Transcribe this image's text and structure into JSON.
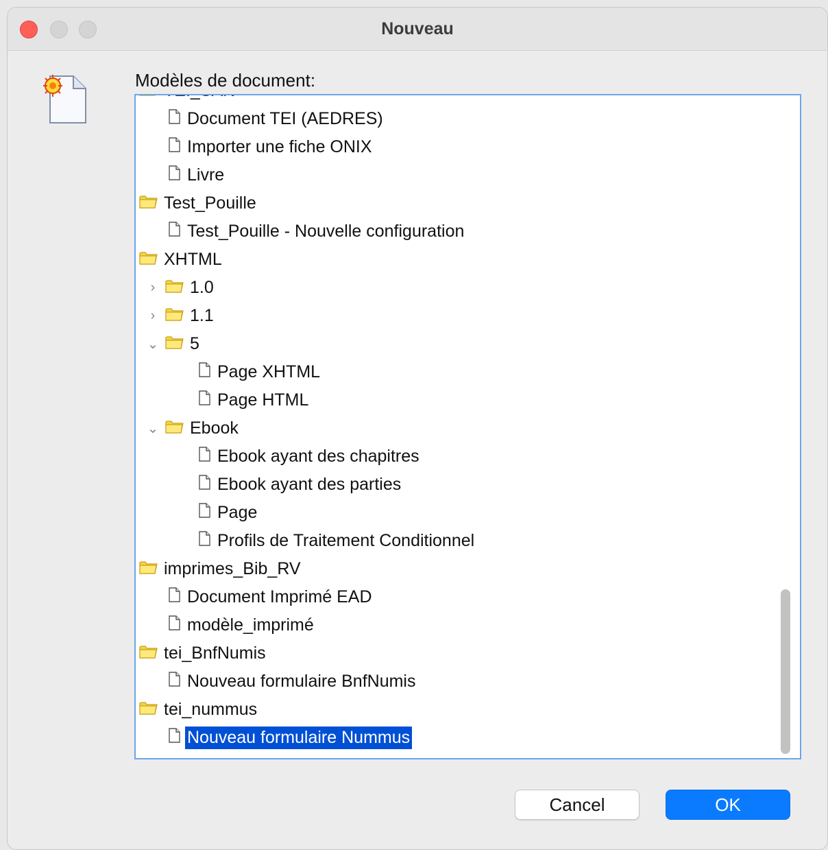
{
  "window": {
    "title": "Nouveau"
  },
  "list": {
    "label": "Modèles de document:"
  },
  "tree": [
    {
      "label": "TEI_SAN",
      "kind": "folder",
      "level": 0,
      "arrow": ""
    },
    {
      "label": "Document TEI (AEDRES)",
      "kind": "file",
      "level": 1,
      "arrow": ""
    },
    {
      "label": "Importer une fiche ONIX",
      "kind": "file",
      "level": 1,
      "arrow": ""
    },
    {
      "label": "Livre",
      "kind": "file",
      "level": 1,
      "arrow": ""
    },
    {
      "label": "Test_Pouille",
      "kind": "folder",
      "level": 0,
      "arrow": ""
    },
    {
      "label": "Test_Pouille - Nouvelle configuration",
      "kind": "file",
      "level": 1,
      "arrow": ""
    },
    {
      "label": "XHTML",
      "kind": "folder",
      "level": 0,
      "arrow": ""
    },
    {
      "label": "1.0",
      "kind": "folder",
      "level": 1,
      "arrow": "collapsed"
    },
    {
      "label": "1.1",
      "kind": "folder",
      "level": 1,
      "arrow": "collapsed"
    },
    {
      "label": "5",
      "kind": "folder",
      "level": 1,
      "arrow": "expanded"
    },
    {
      "label": "Page XHTML",
      "kind": "file",
      "level": 2,
      "arrow": ""
    },
    {
      "label": "Page HTML",
      "kind": "file",
      "level": 2,
      "arrow": ""
    },
    {
      "label": "Ebook",
      "kind": "folder",
      "level": 1,
      "arrow": "expanded"
    },
    {
      "label": "Ebook ayant des chapitres",
      "kind": "file",
      "level": 2,
      "arrow": ""
    },
    {
      "label": "Ebook ayant des parties",
      "kind": "file",
      "level": 2,
      "arrow": ""
    },
    {
      "label": "Page",
      "kind": "file",
      "level": 2,
      "arrow": ""
    },
    {
      "label": "Profils de Traitement Conditionnel",
      "kind": "file",
      "level": 2,
      "arrow": ""
    },
    {
      "label": "imprimes_Bib_RV",
      "kind": "folder",
      "level": 0,
      "arrow": ""
    },
    {
      "label": "Document Imprimé EAD",
      "kind": "file",
      "level": 1,
      "arrow": ""
    },
    {
      "label": "modèle_imprimé",
      "kind": "file",
      "level": 1,
      "arrow": ""
    },
    {
      "label": "tei_BnfNumis",
      "kind": "folder",
      "level": 0,
      "arrow": ""
    },
    {
      "label": "Nouveau formulaire BnfNumis",
      "kind": "file",
      "level": 1,
      "arrow": ""
    },
    {
      "label": "tei_nummus",
      "kind": "folder",
      "level": 0,
      "arrow": ""
    },
    {
      "label": "Nouveau formulaire Nummus",
      "kind": "file",
      "level": 1,
      "arrow": "",
      "selected": true
    }
  ],
  "buttons": {
    "cancel": "Cancel",
    "ok": "OK"
  },
  "colors": {
    "selection": "#0050d6",
    "accent": "#0a7bff",
    "folder": "#f5d442"
  }
}
